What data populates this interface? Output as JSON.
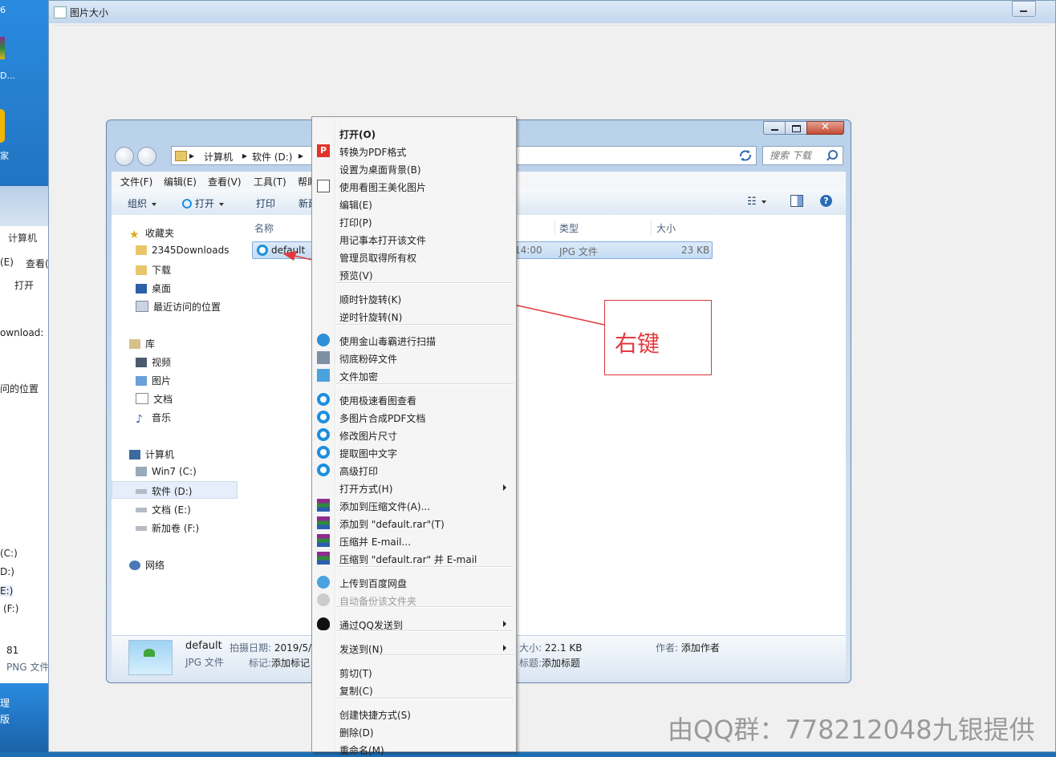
{
  "outer_window": {
    "title": "图片大小"
  },
  "desktop": {
    "icon_labels": [
      "6",
      "D...",
      "家"
    ]
  },
  "background_window": {
    "texts": [
      "计算机",
      "(E)",
      "查看(",
      "打开",
      "ownload:",
      "问的位置",
      "(C:)",
      "D:)",
      "E:)",
      "(F:)",
      "81",
      "PNG 文件",
      "理",
      "版"
    ]
  },
  "explorer": {
    "address": {
      "crumbs": [
        "计算机",
        "软件 (D:)"
      ]
    },
    "search": {
      "placeholder": "搜索 下载"
    },
    "menubar": [
      "文件(F)",
      "编辑(E)",
      "查看(V)",
      "工具(T)",
      "帮助"
    ],
    "commandbar": {
      "organize": "组织",
      "open": "打开",
      "print": "打印",
      "new_folder": "新建"
    },
    "nav": {
      "favorites": "收藏夹",
      "favorites_items": [
        "2345Downloads",
        "下载",
        "桌面",
        "最近访问的位置"
      ],
      "libraries": "库",
      "libraries_items": [
        "视频",
        "图片",
        "文档",
        "音乐"
      ],
      "computer": "计算机",
      "computer_items": [
        "Win7 (C:)",
        "软件 (D:)",
        "文档 (E:)",
        "新加卷 (F:)"
      ],
      "network": "网络"
    },
    "columns": {
      "name": "名称",
      "type": "类型",
      "size": "大小"
    },
    "file": {
      "name": "default",
      "date_fragment": "14:00",
      "type": "JPG 文件",
      "size": "23 KB"
    },
    "details": {
      "name": "default",
      "filetype": "JPG 文件",
      "date_label": "拍摄日期:",
      "date_value": "2019/5/",
      "tags_label": "标记:",
      "tags_value": "添加标记",
      "size_label": "大小:",
      "size_value": "22.1 KB",
      "title_label": "标题:",
      "title_value": "添加标题",
      "author_label": "作者:",
      "author_value": "添加作者"
    }
  },
  "context_menu": {
    "items": [
      "打开(O)",
      "转换为PDF格式",
      "设置为桌面背景(B)",
      "使用看图王美化图片",
      "编辑(E)",
      "打印(P)",
      "用记事本打开该文件",
      "管理员取得所有权",
      "预览(V)",
      "顺时针旋转(K)",
      "逆时针旋转(N)",
      "使用金山毒霸进行扫描",
      "彻底粉碎文件",
      "文件加密",
      "使用极速看图查看",
      "多图片合成PDF文档",
      "修改图片尺寸",
      "提取图中文字",
      "高级打印",
      "打开方式(H)",
      "添加到压缩文件(A)...",
      "添加到 \"default.rar\"(T)",
      "压缩并 E-mail...",
      "压缩到 \"default.rar\" 并 E-mail",
      "上传到百度网盘",
      "自动备份该文件夹",
      "通过QQ发送到",
      "发送到(N)",
      "剪切(T)",
      "复制(C)",
      "创建快捷方式(S)",
      "删除(D)",
      "重命名(M)"
    ]
  },
  "annotation": {
    "label": "右键",
    "color": "#e4393c"
  },
  "watermark": "由QQ群：778212048九银提供"
}
